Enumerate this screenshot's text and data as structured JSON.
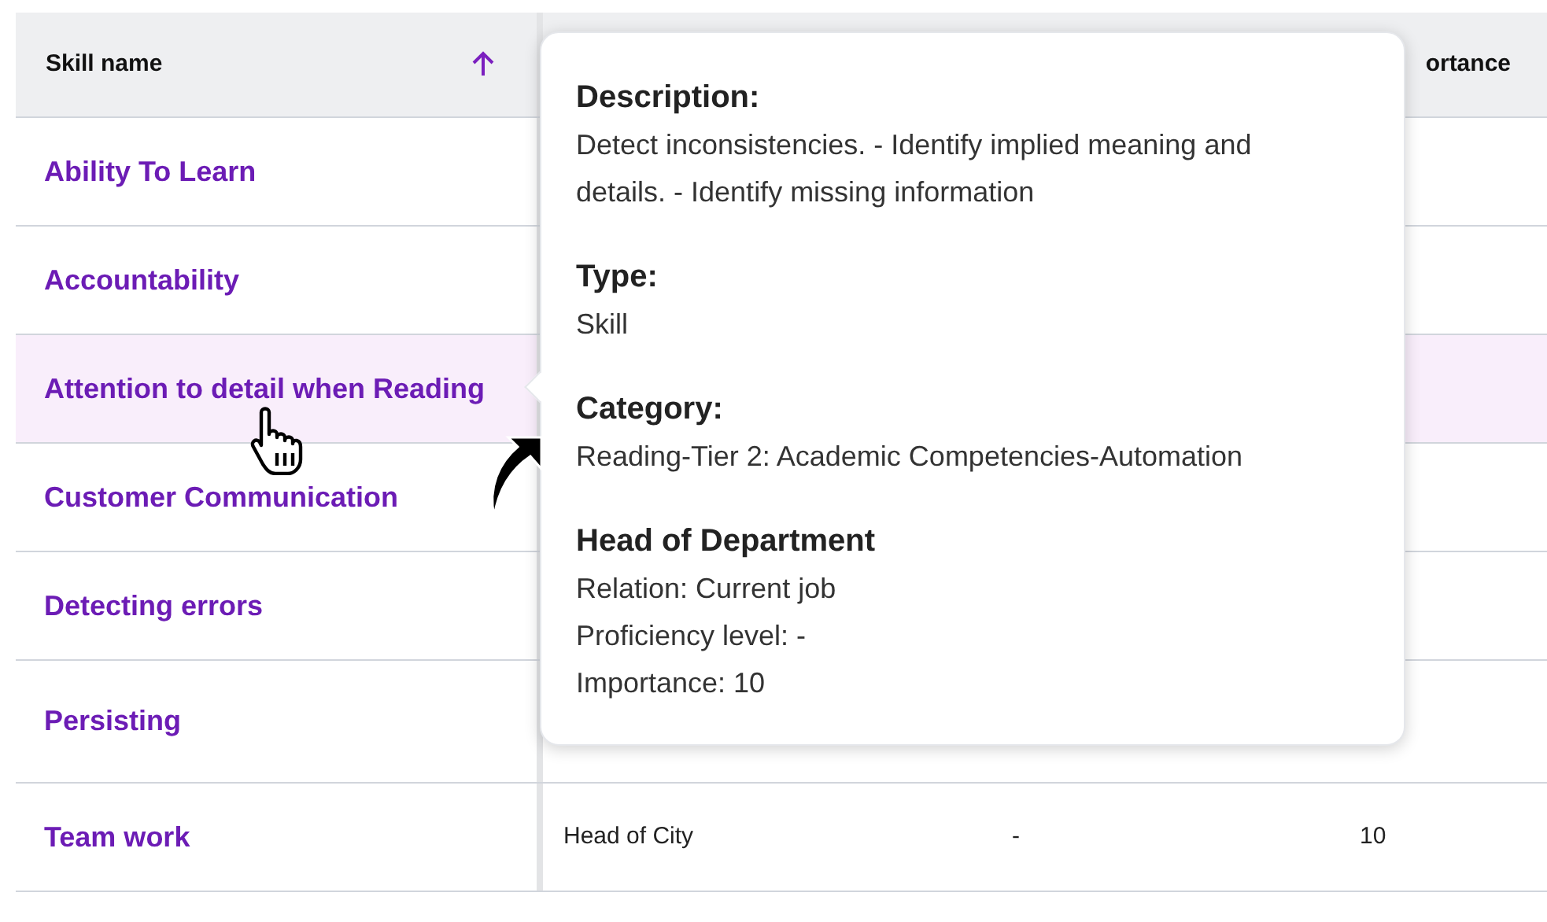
{
  "table": {
    "header": {
      "skill_name": {
        "label": "Skill name",
        "sorted": true
      },
      "column_4": "ortance"
    },
    "rows": [
      {
        "skill": "Ability To Learn",
        "hovered": false
      },
      {
        "skill": "Accountability",
        "hovered": false
      },
      {
        "skill": "Attention to detail when Reading",
        "hovered": true
      },
      {
        "skill": "Customer Communication",
        "hovered": false
      },
      {
        "skill": "Detecting errors",
        "hovered": false
      },
      {
        "skill": "Persisting",
        "hovered": false
      },
      {
        "skill": "Team work",
        "hovered": false,
        "column_2": "Head of City",
        "column_3": "-",
        "column_4": "10"
      }
    ]
  },
  "tooltip": {
    "sections": [
      {
        "heading": "Description:",
        "text": "Detect inconsistencies. - Identify implied meaning and details. - Identify missing information"
      },
      {
        "heading": "Type:",
        "text": "Skill"
      },
      {
        "heading": "Category:",
        "text": "Reading-Tier 2: Academic Competencies-Automation"
      },
      {
        "heading": "Head of Department",
        "lines": [
          "Relation: Current job",
          "Proficiency level: -",
          "Importance: 10"
        ]
      }
    ]
  }
}
